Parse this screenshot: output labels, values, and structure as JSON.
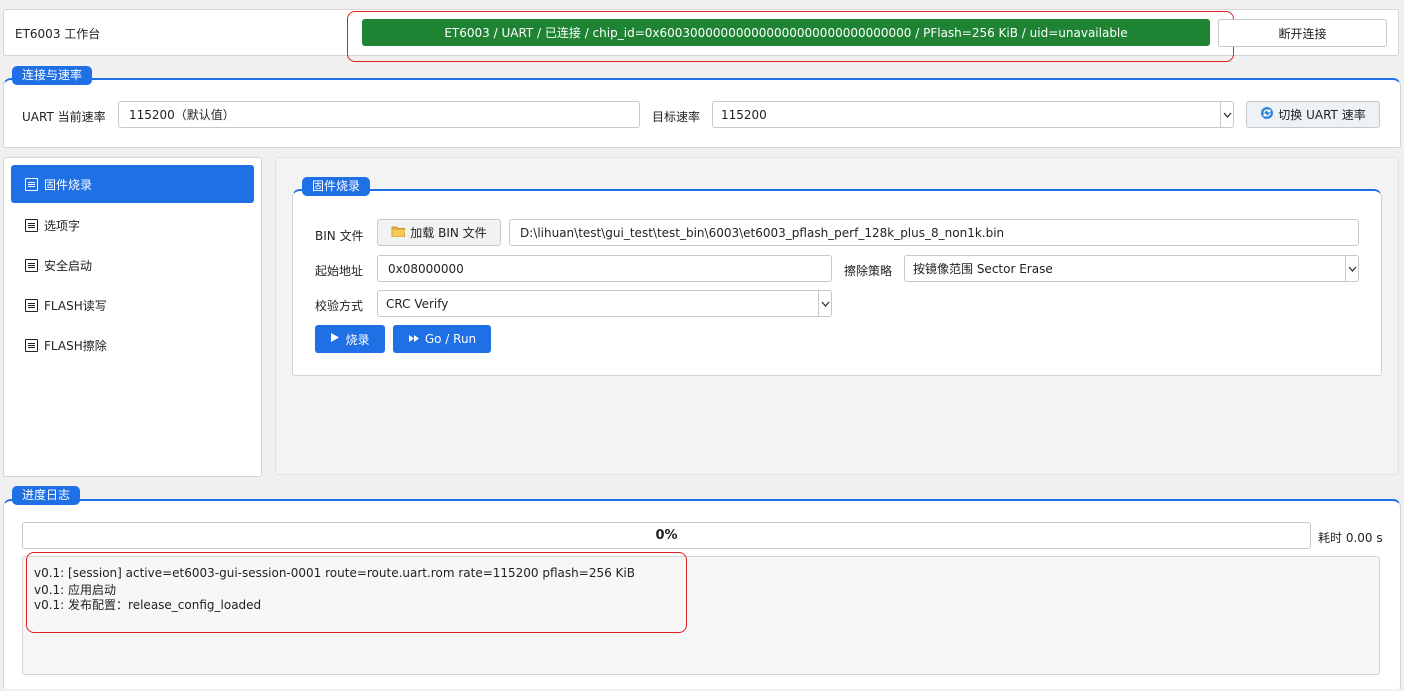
{
  "header": {
    "app_title": "ET6003 工作台",
    "status_text": "ET6003 / UART / 已连接 / chip_id=0x600300000000000000000000000000000 / PFlash=256 KiB / uid=unavailable",
    "status_color": "#1e8434",
    "disconnect_label": "断开连接"
  },
  "connection": {
    "title": "连接与速率",
    "current_rate_label": "UART 当前速率",
    "current_rate_value": "115200（默认值）",
    "target_rate_label": "目标速率",
    "target_rate_value": "115200",
    "switch_button_label": "切换 UART 速率",
    "switch_icon": "refresh-icon"
  },
  "sidebar": {
    "items": [
      {
        "label": "固件烧录",
        "icon": "document-icon",
        "active": true
      },
      {
        "label": "选项字",
        "icon": "document-icon",
        "active": false
      },
      {
        "label": "安全启动",
        "icon": "document-icon",
        "active": false
      },
      {
        "label": "FLASH读写",
        "icon": "document-icon",
        "active": false
      },
      {
        "label": "FLASH擦除",
        "icon": "document-icon",
        "active": false
      }
    ]
  },
  "burn": {
    "title": "固件烧录",
    "bin_label": "BIN 文件",
    "load_bin_label": "加载 BIN 文件",
    "load_icon": "folder-icon",
    "bin_path": "D:\\lihuan\\test\\gui_test\\test_bin\\6003\\et6003_pflash_perf_128k_plus_8_non1k.bin",
    "start_addr_label": "起始地址",
    "start_addr_value": "0x08000000",
    "erase_label": "擦除策略",
    "erase_value": "按镜像范围 Sector Erase",
    "verify_label": "校验方式",
    "verify_value": "CRC Verify",
    "burn_button_label": "烧录",
    "burn_icon": "play-icon",
    "run_button_label": "Go / Run",
    "run_icon": "fast-forward-icon"
  },
  "log": {
    "title": "进度日志",
    "progress_text": "0%",
    "progress_value": 0,
    "elapsed_text": "耗时 0.00 s",
    "lines": [
      "v0.1: [session] active=et6003-gui-session-0001 route=route.uart.rom rate=115200 pflash=256 KiB",
      "v0.1: 应用启动",
      "v0.1: 发布配置：release_config_loaded"
    ]
  },
  "colors": {
    "accent": "#1f6fe5",
    "highlight": "#e02020"
  }
}
